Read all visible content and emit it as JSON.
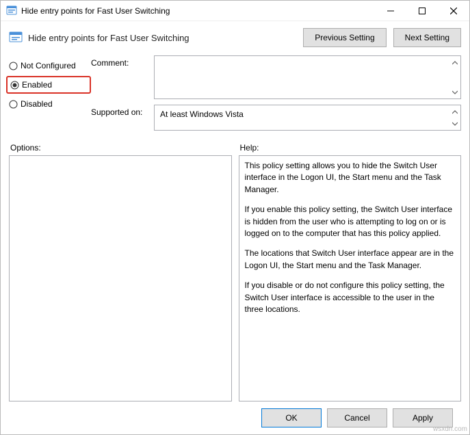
{
  "window": {
    "title": "Hide entry points for Fast User Switching"
  },
  "header": {
    "heading": "Hide entry points for Fast User Switching",
    "previous_setting": "Previous Setting",
    "next_setting": "Next Setting"
  },
  "radios": {
    "not_configured": "Not Configured",
    "enabled": "Enabled",
    "disabled": "Disabled",
    "selected": "enabled"
  },
  "fields": {
    "comment_label": "Comment:",
    "comment_value": "",
    "supported_label": "Supported on:",
    "supported_value": "At least Windows Vista"
  },
  "panels": {
    "options_label": "Options:",
    "options_value": "",
    "help_label": "Help:"
  },
  "help": {
    "p1": "This policy setting allows you to hide the Switch User interface in the Logon UI, the Start menu and the Task Manager.",
    "p2": "If you enable this policy setting, the Switch User interface is hidden from the user who is attempting to log on or is logged on to the computer that has this policy applied.",
    "p3": "The locations that Switch User interface appear are in the Logon UI, the Start menu and the Task Manager.",
    "p4": "If you disable or do not configure this policy setting, the Switch User interface is accessible to the user in the three locations."
  },
  "footer": {
    "ok": "OK",
    "cancel": "Cancel",
    "apply": "Apply"
  },
  "watermark": "wsxdn.com"
}
